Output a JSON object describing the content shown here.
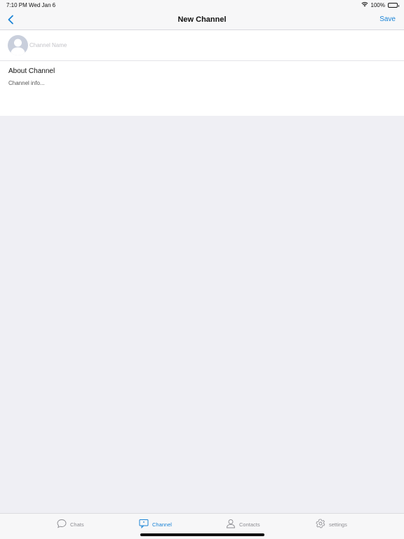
{
  "status_bar": {
    "time": "7:10 PM",
    "date": "Wed Jan 6",
    "battery": "100%"
  },
  "nav": {
    "title": "New Channel",
    "save_label": "Save",
    "back_icon": "chevron-left-icon"
  },
  "form": {
    "name_placeholder": "Channel Name",
    "name_value": "",
    "about_title": "About Channel",
    "about_placeholder": "Channel info...",
    "about_value": ""
  },
  "tabs": [
    {
      "label": "Chats",
      "icon": "chat-bubble-icon",
      "active": false
    },
    {
      "label": "Channel",
      "icon": "channel-icon",
      "active": true
    },
    {
      "label": "Contacts",
      "icon": "person-icon",
      "active": false
    },
    {
      "label": "settings",
      "icon": "gear-icon",
      "active": false
    }
  ],
  "colors": {
    "accent": "#1b84d6",
    "background": "#efeff4",
    "inactive": "#8e8e93"
  }
}
